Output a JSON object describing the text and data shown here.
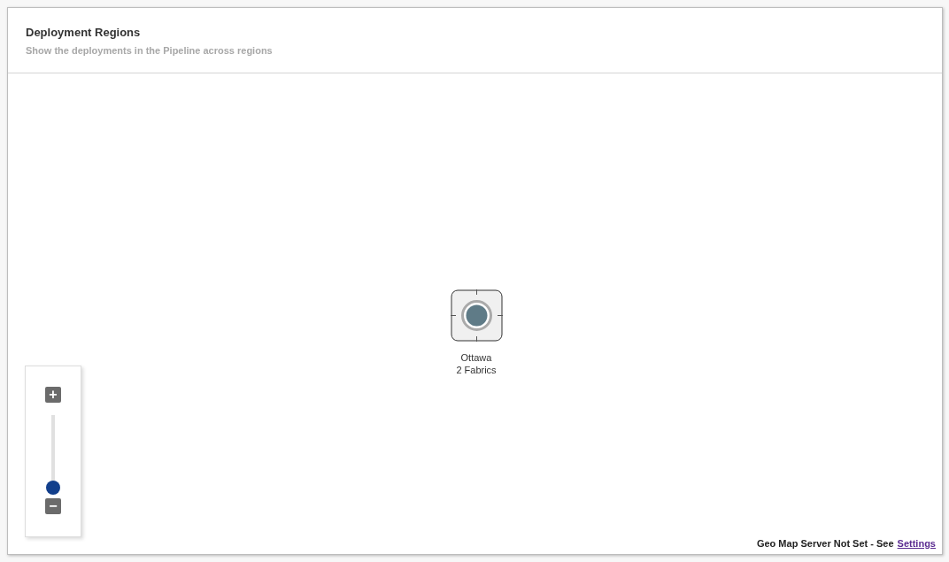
{
  "panel": {
    "title": "Deployment Regions",
    "subtitle": "Show the deployments in the Pipeline across regions"
  },
  "map": {
    "markers": [
      {
        "name": "Ottawa",
        "detail": "2 Fabrics"
      }
    ],
    "zoom": {
      "plus": "+",
      "minus": "−",
      "level": 0
    },
    "notice": {
      "text": "Geo Map Server Not Set - See",
      "link": "Settings"
    }
  }
}
